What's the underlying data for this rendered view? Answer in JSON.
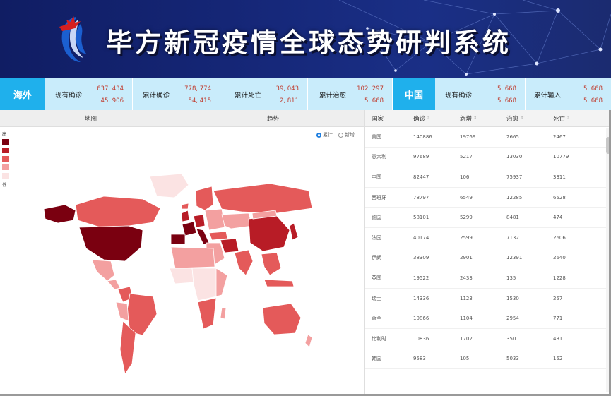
{
  "header": {
    "title": "毕方新冠疫情全球态势研判系统"
  },
  "stats": {
    "overseas_label": "海外",
    "china_label": "中国",
    "items": [
      {
        "label": "现有确诊",
        "v1": "637, 434",
        "v2": "45, 906"
      },
      {
        "label": "累计确诊",
        "v1": "778, 774",
        "v2": "54, 415"
      },
      {
        "label": "累计死亡",
        "v1": "39, 043",
        "v2": "2, 811"
      },
      {
        "label": "累计治愈",
        "v1": "102, 297",
        "v2": "5, 668"
      },
      {
        "label": "现有确诊",
        "v1": "5, 668",
        "v2": "5, 668"
      },
      {
        "label": "累计输入",
        "v1": "5, 668",
        "v2": "5, 668"
      }
    ]
  },
  "tabs": [
    "地图",
    "趋势"
  ],
  "radios": [
    {
      "label": "累计",
      "checked": true
    },
    {
      "label": "新增",
      "checked": false
    }
  ],
  "map_legend": {
    "high_label": "高",
    "low_label": "低",
    "colors": [
      "#7a0010",
      "#b81c26",
      "#e45a5a",
      "#f3a0a0",
      "#fbe3e3"
    ]
  },
  "table": {
    "headers": [
      "国家",
      "确诊",
      "新增",
      "治愈",
      "死亡"
    ],
    "sort_icon": "⇕",
    "rows": [
      [
        "美国",
        "140886",
        "19769",
        "2665",
        "2467"
      ],
      [
        "意大利",
        "97689",
        "5217",
        "13030",
        "10779"
      ],
      [
        "中国",
        "82447",
        "106",
        "75937",
        "3311"
      ],
      [
        "西班牙",
        "78797",
        "6549",
        "12285",
        "6528"
      ],
      [
        "德国",
        "58101",
        "5299",
        "8481",
        "474"
      ],
      [
        "法国",
        "40174",
        "2599",
        "7132",
        "2606"
      ],
      [
        "伊朗",
        "38309",
        "2901",
        "12391",
        "2640"
      ],
      [
        "英国",
        "19522",
        "2433",
        "135",
        "1228"
      ],
      [
        "瑞士",
        "14336",
        "1123",
        "1530",
        "257"
      ],
      [
        "荷兰",
        "10866",
        "1104",
        "2954",
        "771"
      ],
      [
        "比利时",
        "10836",
        "1702",
        "350",
        "431"
      ],
      [
        "韩国",
        "9583",
        "105",
        "5033",
        "152"
      ]
    ]
  }
}
